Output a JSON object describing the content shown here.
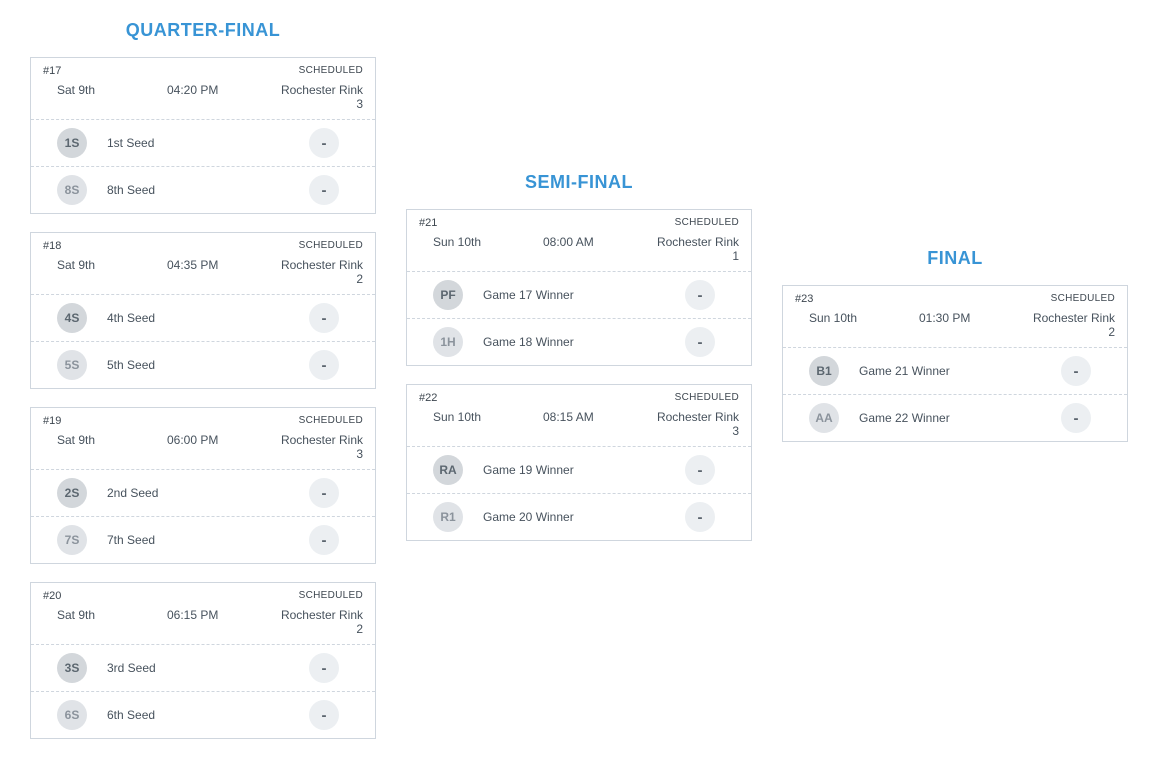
{
  "rounds": [
    {
      "title": "QUARTER-FINAL",
      "offset": 0,
      "games": [
        {
          "num": "#17",
          "status": "SCHEDULED",
          "date": "Sat 9th",
          "time": "04:20 PM",
          "loc": "Rochester Rink 3",
          "t1": {
            "av": "1S",
            "name": "1st Seed",
            "score": "-",
            "dark": true
          },
          "t2": {
            "av": "8S",
            "name": "8th Seed",
            "score": "-",
            "dark": false
          }
        },
        {
          "num": "#18",
          "status": "SCHEDULED",
          "date": "Sat 9th",
          "time": "04:35 PM",
          "loc": "Rochester Rink 2",
          "t1": {
            "av": "4S",
            "name": "4th Seed",
            "score": "-",
            "dark": true
          },
          "t2": {
            "av": "5S",
            "name": "5th Seed",
            "score": "-",
            "dark": false
          }
        },
        {
          "num": "#19",
          "status": "SCHEDULED",
          "date": "Sat 9th",
          "time": "06:00 PM",
          "loc": "Rochester Rink 3",
          "t1": {
            "av": "2S",
            "name": "2nd Seed",
            "score": "-",
            "dark": true
          },
          "t2": {
            "av": "7S",
            "name": "7th Seed",
            "score": "-",
            "dark": false
          }
        },
        {
          "num": "#20",
          "status": "SCHEDULED",
          "date": "Sat 9th",
          "time": "06:15 PM",
          "loc": "Rochester Rink 2",
          "t1": {
            "av": "3S",
            "name": "3rd Seed",
            "score": "-",
            "dark": true
          },
          "t2": {
            "av": "6S",
            "name": "6th Seed",
            "score": "-",
            "dark": false
          }
        }
      ]
    },
    {
      "title": "SEMI-FINAL",
      "offset": 167,
      "games": [
        {
          "num": "#21",
          "status": "SCHEDULED",
          "date": "Sun 10th",
          "time": "08:00 AM",
          "loc": "Rochester Rink 1",
          "t1": {
            "av": "PF",
            "name": "Game 17 Winner",
            "score": "-",
            "dark": true
          },
          "t2": {
            "av": "1H",
            "name": "Game 18 Winner",
            "score": "-",
            "dark": false
          }
        },
        {
          "num": "#22",
          "status": "SCHEDULED",
          "date": "Sun 10th",
          "time": "08:15 AM",
          "loc": "Rochester Rink 3",
          "t1": {
            "av": "RA",
            "name": "Game 19 Winner",
            "score": "-",
            "dark": true
          },
          "t2": {
            "av": "R1",
            "name": "Game 20 Winner",
            "score": "-",
            "dark": false
          }
        }
      ]
    },
    {
      "title": "FINAL",
      "offset": 244,
      "games": [
        {
          "num": "#23",
          "status": "SCHEDULED",
          "date": "Sun 10th",
          "time": "01:30 PM",
          "loc": "Rochester Rink 2",
          "t1": {
            "av": "B1",
            "name": "Game 21 Winner",
            "score": "-",
            "dark": true
          },
          "t2": {
            "av": "AA",
            "name": "Game 22 Winner",
            "score": "-",
            "dark": false
          }
        }
      ]
    }
  ]
}
